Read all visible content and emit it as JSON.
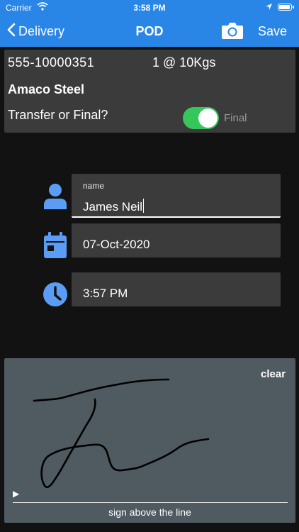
{
  "status_bar": {
    "carrier": "Carrier",
    "time": "3:58 PM"
  },
  "nav": {
    "back_label": "Delivery",
    "title": "POD",
    "save_label": "Save",
    "camera_icon": "camera-icon"
  },
  "info": {
    "order_number": "555-10000351",
    "quantity": "1 @ 10Kgs",
    "company": "Amaco Steel",
    "question": "Transfer or Final?",
    "toggle_on": true,
    "toggle_label": "Final"
  },
  "form": {
    "name_label": "name",
    "name_value": "James Neil",
    "date_value": "07-Oct-2020",
    "time_value": "3:57 PM"
  },
  "signature": {
    "clear_label": "clear",
    "marker": "▶",
    "caption": "sign above the line"
  },
  "colors": {
    "nav_blue": "#2a86e6",
    "icon_blue": "#5b9df5",
    "toggle_green": "#34c759",
    "card_gray": "#3b3b3b",
    "sig_bg": "#4f5a61"
  }
}
